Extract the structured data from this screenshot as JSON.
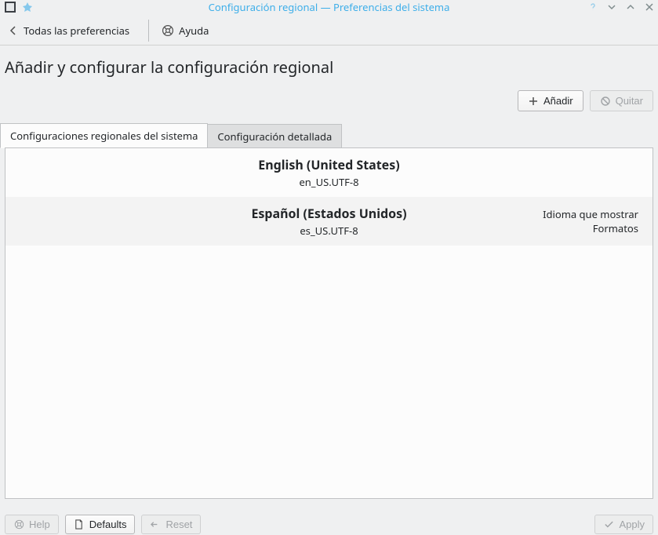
{
  "window": {
    "title": "Configuración regional — Preferencias del sistema"
  },
  "toolbar": {
    "back_label": "Todas las preferencias",
    "help_label": "Ayuda"
  },
  "heading": "Añadir y configurar la configuración regional",
  "actions": {
    "add_label": "Añadir",
    "remove_label": "Quitar"
  },
  "tabs": {
    "system_locales": "Configuraciones regionales del sistema",
    "detailed": "Configuración detallada"
  },
  "locales": [
    {
      "name": "English (United States)",
      "code": "en_US.UTF-8",
      "meta1": "",
      "meta2": ""
    },
    {
      "name": "Español (Estados Unidos)",
      "code": "es_US.UTF-8",
      "meta1": "Idioma que mostrar",
      "meta2": "Formatos"
    }
  ],
  "footer": {
    "help_label": "Help",
    "defaults_label": "Defaults",
    "reset_label": "Reset",
    "apply_label": "Apply"
  }
}
